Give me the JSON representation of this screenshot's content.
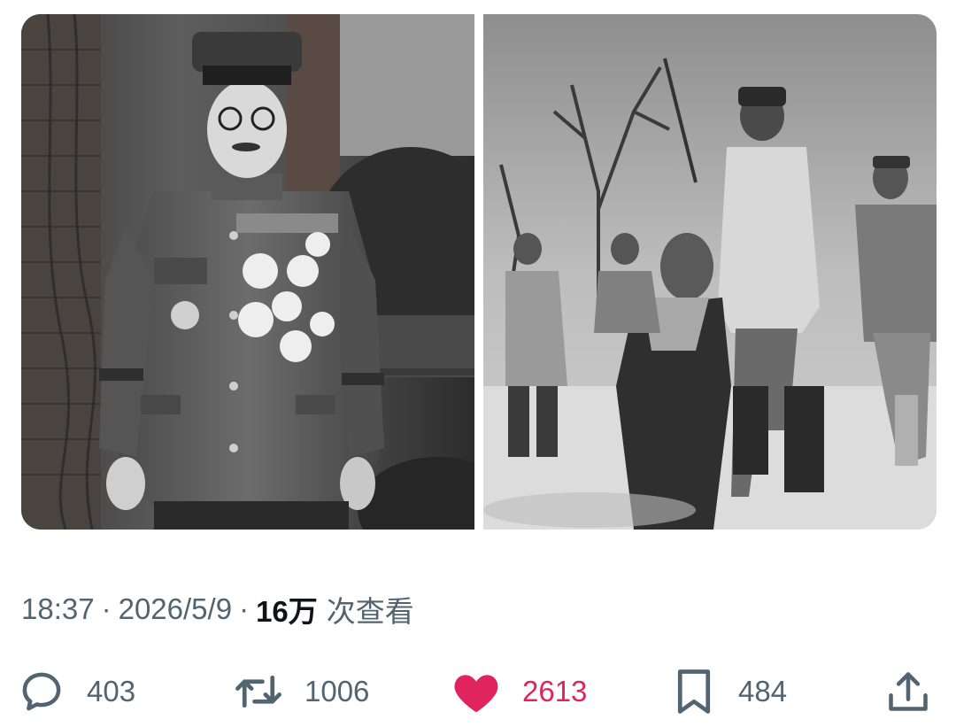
{
  "media": [
    {
      "alt": ""
    },
    {
      "alt": ""
    }
  ],
  "meta": {
    "time": "18:37",
    "separator": "·",
    "date": "2026/5/9",
    "views_count": "16万",
    "views_label": "次查看"
  },
  "actions": {
    "reply": {
      "icon": "reply-bubble-icon",
      "count": "403"
    },
    "repost": {
      "icon": "repost-icon",
      "count": "1006"
    },
    "like": {
      "icon": "heart-filled-icon",
      "count": "2613",
      "active": true,
      "color": "#e0245e"
    },
    "bookmark": {
      "icon": "bookmark-icon",
      "count": "484"
    },
    "share": {
      "icon": "share-upload-icon"
    }
  },
  "colors": {
    "secondary_text": "#536471",
    "primary_text": "#0f1419",
    "like_active": "#e0245e"
  }
}
